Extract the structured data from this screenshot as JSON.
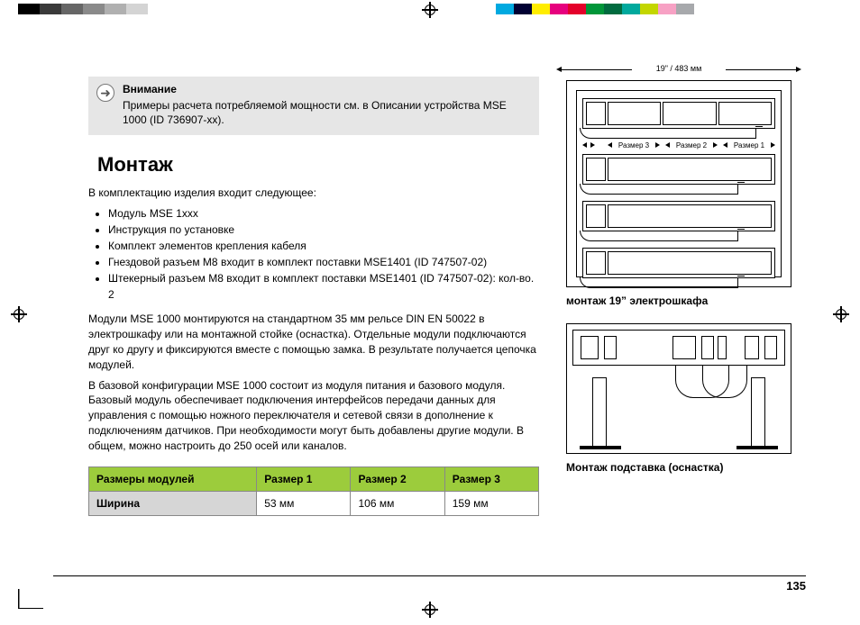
{
  "alert": {
    "title": "Внимание",
    "body": "Примеры расчета потребляемой мощности см. в Описании устройства MSE 1000 (ID 736907-xx)."
  },
  "section_heading": "Монтаж",
  "intro": "В комплектацию изделия входит следующее:",
  "bullets": [
    "Модуль MSE 1xxx",
    "Инструкция по установке",
    "Комплект элементов крепления кабеля",
    "Гнездовой разъем M8 входит в комплект поставки MSE1401 (ID 747507-02)",
    "Штекерный разъем M8 входит в комплект поставки MSE1401 (ID 747507-02): кол-во. 2"
  ],
  "body1": "Модули MSE 1000 монтируются на стандартном 35 мм рельсе DIN EN 50022 в электрошкафу или на монтажной стойке (оснастка). Отдельные модули подключаются друг ко другу и фиксируются вместе с помощью замка. В результате получается цепочка модулей.",
  "body2": "В базовой конфигурации MSE 1000 состоит из модуля питания и базового модуля. Базовый модуль обеспечивает подключения интерфейсов передачи данных для управления с помощью ножного переключателя и сетевой связи в дополнение к подключениям датчиков. При необходимости могут быть добавлены другие модули. В общем, можно настроить до 250 осей или каналов.",
  "table": {
    "head": [
      "Размеры модулей",
      "Размер 1",
      "Размер 2",
      "Размер 3"
    ],
    "row_label": "Ширина",
    "row": [
      "53 мм",
      "106 мм",
      "159 мм"
    ]
  },
  "fig1": {
    "dimension": "19\" / 483 мм",
    "size_labels": [
      "Размер 3",
      "Размер 2",
      "Размер 1"
    ],
    "caption": "монтаж 19” электрошкафа"
  },
  "fig2": {
    "caption": "Монтаж подставка (оснастка)"
  },
  "page_number": "135",
  "print_colors": [
    "#000000",
    "#3a3a3a",
    "#666666",
    "#8a8a8a",
    "#b0b0b0",
    "#d4d4d4",
    "#00a9e0",
    "#e4002b",
    "#ffed00",
    "#e6007e",
    "#009639",
    "#00a99d",
    "#c3d600",
    "#f7a1c4",
    "#a7a9ac"
  ]
}
